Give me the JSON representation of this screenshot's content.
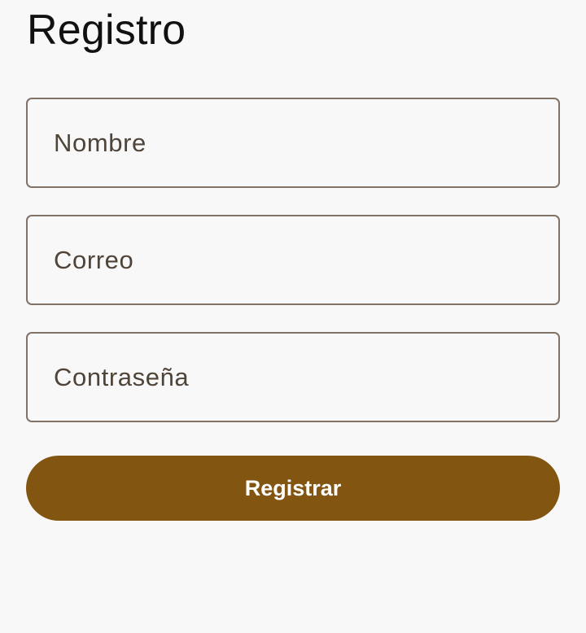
{
  "form": {
    "title": "Registro",
    "name_field": {
      "value": "",
      "placeholder": "Nombre"
    },
    "email_field": {
      "value": "",
      "placeholder": "Correo"
    },
    "password_field": {
      "value": "",
      "placeholder": "Contraseña"
    },
    "submit_label": "Registrar"
  },
  "colors": {
    "background": "#f9f8f8",
    "field_border": "#817266",
    "field_text": "#4f4439",
    "accent": "#825610",
    "button_text": "#ffffff"
  }
}
